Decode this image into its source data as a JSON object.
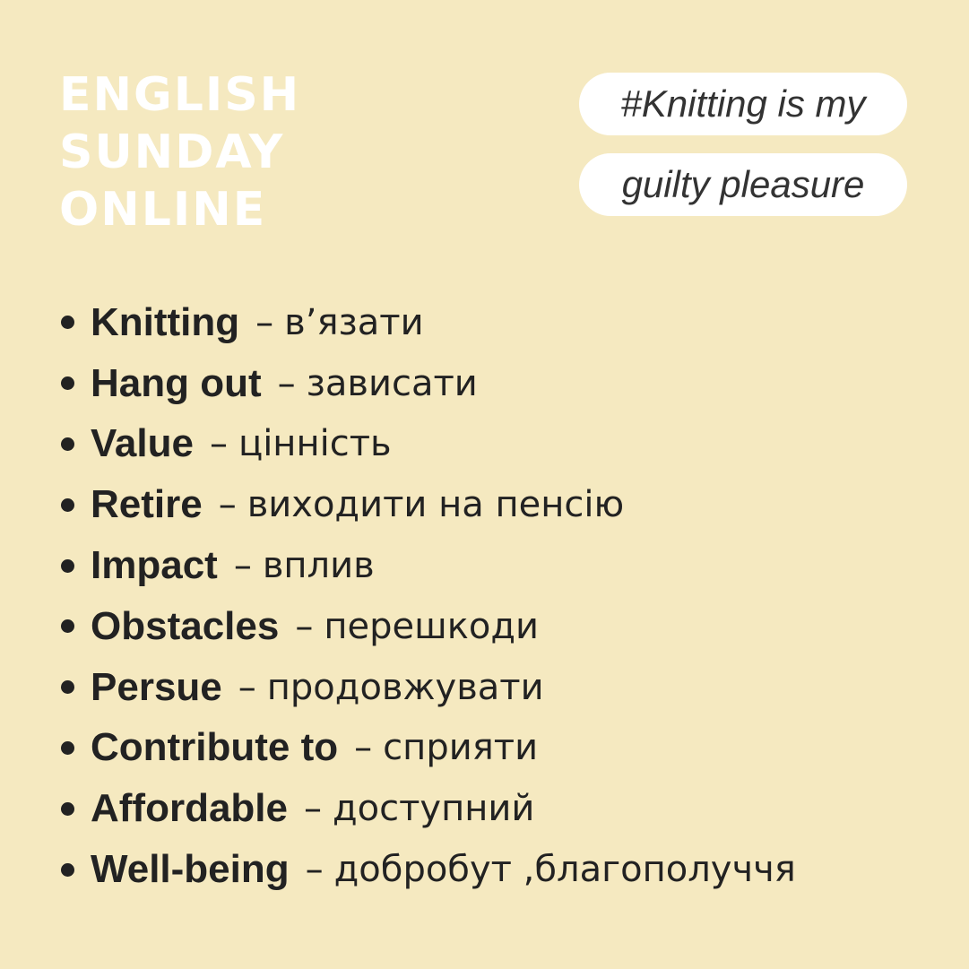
{
  "brand": {
    "line1": "ENGLISH",
    "line2": "SUNDAY",
    "line3": "ONLINE"
  },
  "hashtag": {
    "line1": "#Knitting is my",
    "line2": "guilty pleasure"
  },
  "separator": "–",
  "vocabulary": [
    {
      "term": "Knitting",
      "translation": "в’язати"
    },
    {
      "term": "Hang out",
      "translation": "зависати"
    },
    {
      "term": "Value",
      "translation": "цінність"
    },
    {
      "term": "Retire",
      "translation": "виходити на пенсію"
    },
    {
      "term": "Impact",
      "translation": "вплив"
    },
    {
      "term": "Obstacles",
      "translation": "перешкоди"
    },
    {
      "term": "Persue",
      "translation": "продовжувати"
    },
    {
      "term": "Contribute to",
      "translation": "сприяти"
    },
    {
      "term": "Affordable",
      "translation": "доступний"
    },
    {
      "term": "Well-being",
      "translation": "добробут ,благополуччя"
    }
  ],
  "colors": {
    "background": "#F5E9C0",
    "brand_text": "#FFFFFF",
    "pill_background": "#FFFFFF",
    "body_text": "#222222"
  }
}
